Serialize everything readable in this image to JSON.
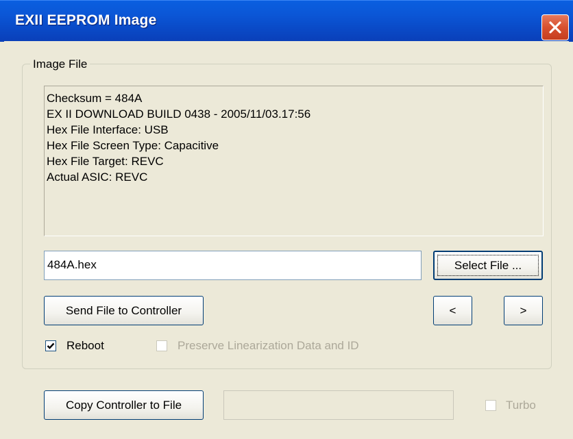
{
  "window": {
    "title": "EXII EEPROM Image",
    "titlebar_color": "#0a54d4",
    "close_color": "#d8502f"
  },
  "group": {
    "label": "Image File"
  },
  "info": {
    "lines": [
      "Checksum = 484A",
      "EX II DOWNLOAD BUILD 0438 - 2005/11/03.17:56",
      "Hex File Interface: USB",
      "Hex File Screen Type: Capacitive",
      "Hex File Target: REVC",
      "Actual ASIC: REVC"
    ]
  },
  "file_field": {
    "value": "484A.hex"
  },
  "buttons": {
    "select_file": "Select File ...",
    "send_file": "Send File to Controller",
    "prev": "<",
    "next": ">",
    "copy_controller": "Copy Controller to File"
  },
  "checkboxes": {
    "reboot": {
      "label": "Reboot",
      "checked": true,
      "enabled": true
    },
    "preserve": {
      "label": "Preserve Linearization Data and ID",
      "checked": false,
      "enabled": false
    },
    "turbo": {
      "label": "Turbo",
      "checked": false,
      "enabled": false
    }
  },
  "copy_field": {
    "value": ""
  }
}
